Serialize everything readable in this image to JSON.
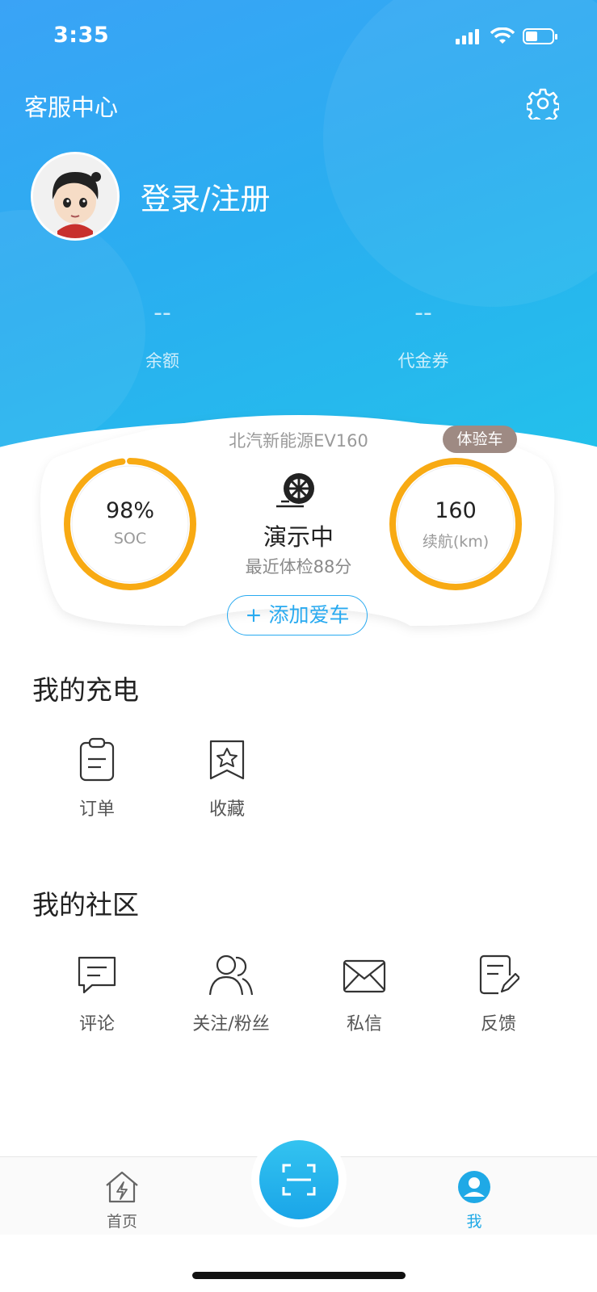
{
  "status_bar": {
    "time": "3:35"
  },
  "header": {
    "customer_service": "客服中心",
    "login_text": "登录/注册"
  },
  "stats": [
    {
      "value": "--",
      "label": "余额"
    },
    {
      "value": "--",
      "label": "代金券"
    }
  ],
  "car": {
    "name": "北汽新能源EV160",
    "badge": "体验车",
    "soc": {
      "value": "98%",
      "label": "SOC",
      "fraction": 0.98
    },
    "range": {
      "value": "160",
      "label": "续航(km)",
      "fraction": 1.0
    },
    "status": "演示中",
    "checkup": "最近体检88分",
    "add_button": "+ 添加爱车",
    "ring_color": "#F8AA13"
  },
  "charging": {
    "title": "我的充电",
    "items": [
      {
        "label": "订单",
        "icon": "clipboard-icon"
      },
      {
        "label": "收藏",
        "icon": "bookmark-star-icon"
      }
    ]
  },
  "community": {
    "title": "我的社区",
    "items": [
      {
        "label": "评论",
        "icon": "comment-icon"
      },
      {
        "label": "关注/粉丝",
        "icon": "people-icon"
      },
      {
        "label": "私信",
        "icon": "mail-icon"
      },
      {
        "label": "反馈",
        "icon": "feedback-edit-icon"
      }
    ]
  },
  "tabbar": {
    "home": "首页",
    "me": "我",
    "active_color": "#1FA9E6"
  }
}
